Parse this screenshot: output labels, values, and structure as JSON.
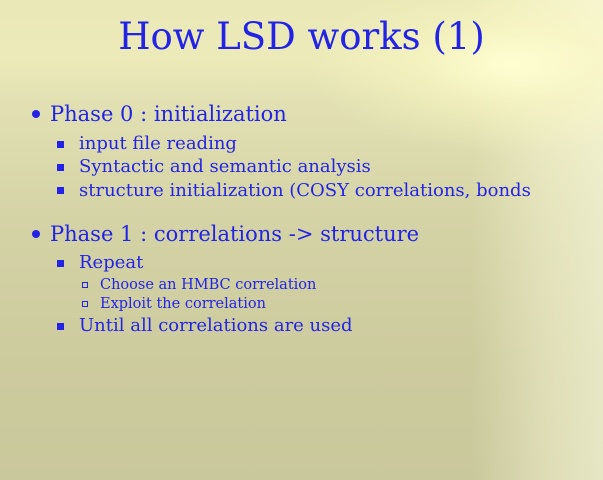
{
  "slide": {
    "title": "How LSD works (1)",
    "phase0": {
      "label": "Phase 0 : initialization",
      "items": [
        "input file reading",
        "Syntactic and semantic analysis",
        "structure initialization (COSY correlations, bonds"
      ]
    },
    "phase1": {
      "label": "Phase 1 : correlations -> structure",
      "repeat": "Repeat",
      "sub_items": [
        "Choose an HMBC correlation",
        "Exploit the correlation"
      ],
      "until": "Until all correlations are used"
    }
  },
  "colors": {
    "text": "#2323e6",
    "background": "#d8d7a8"
  }
}
